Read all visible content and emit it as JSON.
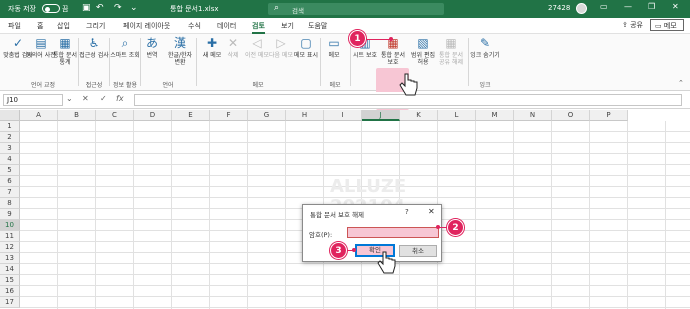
{
  "titlebar": {
    "autosave_label": "자동 저장",
    "autosave_state": "끔",
    "doc_title": "통합 문서1.xlsx",
    "search_placeholder": "검색",
    "user": "27428"
  },
  "menu": {
    "tabs": [
      "파일",
      "홈",
      "삽입",
      "그리기",
      "페이지 레이아웃",
      "수식",
      "데이터",
      "검토",
      "보기",
      "도움말"
    ],
    "active_tab": "검토",
    "share": "공유",
    "comments": "메모"
  },
  "ribbon": {
    "buttons": [
      {
        "label": "맞춤법 검사"
      },
      {
        "label": "동의어 사전"
      },
      {
        "label": "통합 문서 통계"
      },
      {
        "label": "접근성 검사"
      },
      {
        "label": "스마트 조회"
      },
      {
        "label": "번역"
      },
      {
        "label": "한글/한자 변환"
      },
      {
        "label": "새 메모"
      },
      {
        "label": "삭제"
      },
      {
        "label": "이전 메모"
      },
      {
        "label": "다음 메모"
      },
      {
        "label": "메모 표시"
      },
      {
        "label": "메모"
      },
      {
        "label": "시트 보호"
      },
      {
        "label": "통합 문서 보호"
      },
      {
        "label": "범위 편집 허용"
      },
      {
        "label": "통합 문서 공유 해제"
      },
      {
        "label": "잉크 숨기기"
      }
    ],
    "groups": [
      "언어 교정",
      "접근성",
      "정보 활용",
      "언어",
      "메모",
      "메모",
      "보호",
      "잉크"
    ]
  },
  "formula_bar": {
    "name_box": "J10",
    "fx": "fx",
    "content": ""
  },
  "grid": {
    "columns": [
      "A",
      "B",
      "C",
      "D",
      "E",
      "F",
      "G",
      "H",
      "I",
      "J",
      "K",
      "L",
      "M",
      "N",
      "O",
      "P"
    ],
    "rows": [
      "1",
      "2",
      "3",
      "4",
      "5",
      "6",
      "7",
      "8",
      "9",
      "10",
      "11",
      "12",
      "13",
      "14",
      "15",
      "16",
      "17"
    ],
    "selected_column": "J",
    "selected_row": "10",
    "watermark_line1": "ALLUZE",
    "watermark_line2": "202104"
  },
  "dialog": {
    "title": "통합 문서 보호 해제",
    "help": "?",
    "close": "✕",
    "password_label": "암호(P):",
    "ok_label": "확인",
    "cancel_label": "취소"
  },
  "markers": [
    "1",
    "2",
    "3"
  ],
  "colors": {
    "excel_green": "#217346",
    "highlight_pink": "#f7c6d4",
    "marker_red": "#e0245e"
  }
}
